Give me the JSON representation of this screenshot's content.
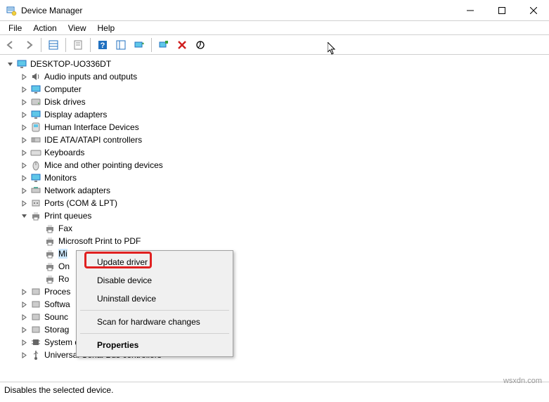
{
  "window": {
    "title": "Device Manager"
  },
  "menu": {
    "file": "File",
    "action": "Action",
    "view": "View",
    "help": "Help"
  },
  "toolbar_icons": {
    "back": "back",
    "forward": "forward",
    "details": "details",
    "props_action": "props-action",
    "help": "help",
    "details2": "details2",
    "monitor": "monitor",
    "scan": "scan",
    "remove": "remove",
    "find": "find"
  },
  "root": {
    "name": "DESKTOP-UO336DT"
  },
  "categories": [
    {
      "id": "audio",
      "label": "Audio inputs and outputs",
      "icon": "speaker"
    },
    {
      "id": "computer",
      "label": "Computer",
      "icon": "monitor"
    },
    {
      "id": "disk",
      "label": "Disk drives",
      "icon": "disk"
    },
    {
      "id": "display",
      "label": "Display adapters",
      "icon": "monitor"
    },
    {
      "id": "hid",
      "label": "Human Interface Devices",
      "icon": "hid"
    },
    {
      "id": "ide",
      "label": "IDE ATA/ATAPI controllers",
      "icon": "ide"
    },
    {
      "id": "keyboard",
      "label": "Keyboards",
      "icon": "keyboard"
    },
    {
      "id": "mouse",
      "label": "Mice and other pointing devices",
      "icon": "mouse"
    },
    {
      "id": "monitors",
      "label": "Monitors",
      "icon": "monitor"
    },
    {
      "id": "network",
      "label": "Network adapters",
      "icon": "network"
    },
    {
      "id": "ports",
      "label": "Ports (COM & LPT)",
      "icon": "port"
    },
    {
      "id": "printq",
      "label": "Print queues",
      "icon": "printer",
      "expanded": true,
      "children": [
        {
          "id": "fax",
          "label": "Fax"
        },
        {
          "id": "mspdf",
          "label": "Microsoft Print to PDF"
        },
        {
          "id": "mi",
          "label": "Mi",
          "selected": true
        },
        {
          "id": "on",
          "label": "On"
        },
        {
          "id": "ro",
          "label": "Ro"
        }
      ]
    },
    {
      "id": "processors",
      "label": "Proces"
    },
    {
      "id": "software",
      "label": "Softwa"
    },
    {
      "id": "sound",
      "label": "Sounc"
    },
    {
      "id": "storage",
      "label": "Storag"
    },
    {
      "id": "system",
      "label": "System devices",
      "icon": "chip"
    },
    {
      "id": "usb",
      "label": "Universal Serial Bus controllers",
      "icon": "usb"
    }
  ],
  "context_menu": {
    "update": "Update driver",
    "disable": "Disable device",
    "uninstall": "Uninstall device",
    "scan": "Scan for hardware changes",
    "properties": "Properties"
  },
  "status": "Disables the selected device.",
  "watermark": "wsxdn.com"
}
